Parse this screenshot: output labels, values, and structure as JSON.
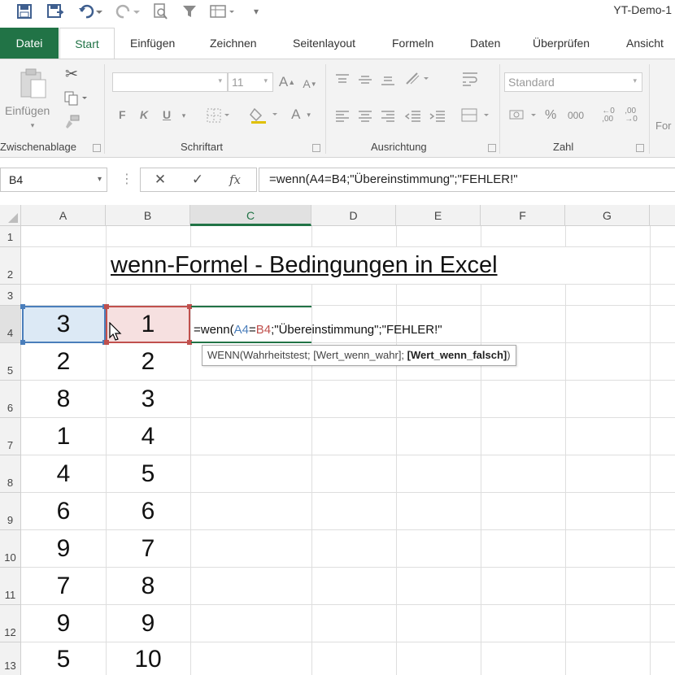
{
  "window": {
    "title": "YT-Demo-1"
  },
  "tabs": [
    "Datei",
    "Start",
    "Einfügen",
    "Zeichnen",
    "Seitenlayout",
    "Formeln",
    "Daten",
    "Überprüfen",
    "Ansicht"
  ],
  "ribbon": {
    "paste_label": "Einfügen",
    "font_size": "11",
    "number_format": "Standard",
    "groups": {
      "clipboard": "Zwischenablage",
      "font": "Schriftart",
      "alignment": "Ausrichtung",
      "number": "Zahl"
    },
    "font_buttons": {
      "bold": "F",
      "italic": "K",
      "underline": "U"
    },
    "percent": "%",
    "thousands": "000",
    "partial_next_group": "For"
  },
  "formula_bar": {
    "name_box": "B4",
    "cancel": "✕",
    "enter": "✓",
    "fx": "fx",
    "formula": "=wenn(A4=B4;\"Übereinstimmung\";\"FEHLER!\""
  },
  "grid": {
    "columns": [
      "A",
      "B",
      "C",
      "D",
      "E",
      "F",
      "G"
    ],
    "selected_column": "C",
    "rows": [
      "1",
      "2",
      "3",
      "4",
      "5",
      "6",
      "7",
      "8",
      "9",
      "10",
      "11",
      "12",
      "13"
    ],
    "title": "wenn-Formel - Bedingungen in Excel",
    "col_a": [
      "3",
      "2",
      "8",
      "1",
      "4",
      "6",
      "9",
      "7",
      "9",
      "5"
    ],
    "col_b": [
      "1",
      "2",
      "3",
      "4",
      "5",
      "6",
      "7",
      "8",
      "9",
      "10"
    ],
    "cell_formula": {
      "prefix": "=wenn(",
      "ref_a": "A4",
      "eq": "=",
      "ref_b": "B4",
      "suffix": ";\"Übereinstimmung\";\"FEHLER!\""
    },
    "tooltip": {
      "fn": "WENN(",
      "arg1": "Wahrheitstest;",
      "arg2": "[Wert_wenn_wahr];",
      "arg3": "[Wert_wenn_falsch]",
      "close": ")"
    }
  },
  "colors": {
    "accent": "#217346",
    "ref_a": "#4a7ebb",
    "ref_b": "#c0504d"
  }
}
